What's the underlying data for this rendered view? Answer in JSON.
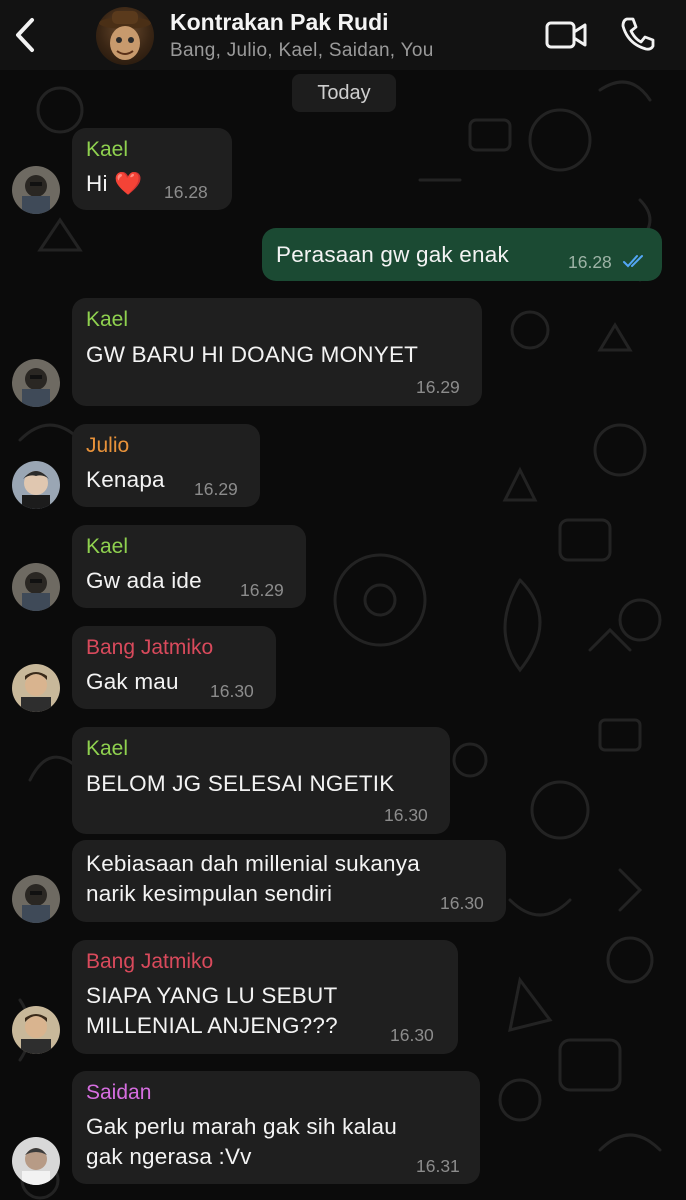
{
  "header": {
    "title": "Kontrakan Pak Rudi",
    "subtitle": "Bang, Julio, Kael, Saidan, You",
    "back_icon": "chevron-left-icon",
    "video_icon": "video-camera-icon",
    "call_icon": "phone-icon"
  },
  "date_chip": "Today",
  "colors": {
    "kael": "#8fd14f",
    "julio": "#e8923a",
    "bang": "#d94a5c",
    "saidan": "#d66ee0",
    "outgoing_bubble": "#1b4a33",
    "incoming_bubble": "#1f1f1f",
    "read_ticks": "#53a6f5"
  },
  "messages": [
    {
      "sender": "Kael",
      "text": "Hi",
      "emoji": "❤️",
      "time": "16.28"
    },
    {
      "sender": "",
      "text": "Perasaan gw gak enak",
      "time": "16.28",
      "outgoing": true,
      "status": "read"
    },
    {
      "sender": "Kael",
      "text": "GW BARU HI DOANG MONYET",
      "time": "16.29"
    },
    {
      "sender": "Julio",
      "text": "Kenapa",
      "time": "16.29"
    },
    {
      "sender": "Kael",
      "text": "Gw ada ide",
      "time": "16.29"
    },
    {
      "sender": "Bang Jatmiko",
      "text": "Gak mau",
      "time": "16.30"
    },
    {
      "sender": "Kael",
      "text": "BELOM JG SELESAI NGETIK",
      "time": "16.30"
    },
    {
      "sender": "",
      "text_line1": "Kebiasaan dah millenial sukanya",
      "text_line2": "narik kesimpulan sendiri",
      "time": "16.30"
    },
    {
      "sender": "Bang Jatmiko",
      "text_line1": "SIAPA YANG LU SEBUT",
      "text_line2": "MILLENIAL ANJENG???",
      "time": "16.30"
    },
    {
      "sender": "Saidan",
      "text_line1": "Gak perlu marah gak sih kalau",
      "text_line2": "gak ngerasa :Vv",
      "time": "16.31"
    }
  ]
}
